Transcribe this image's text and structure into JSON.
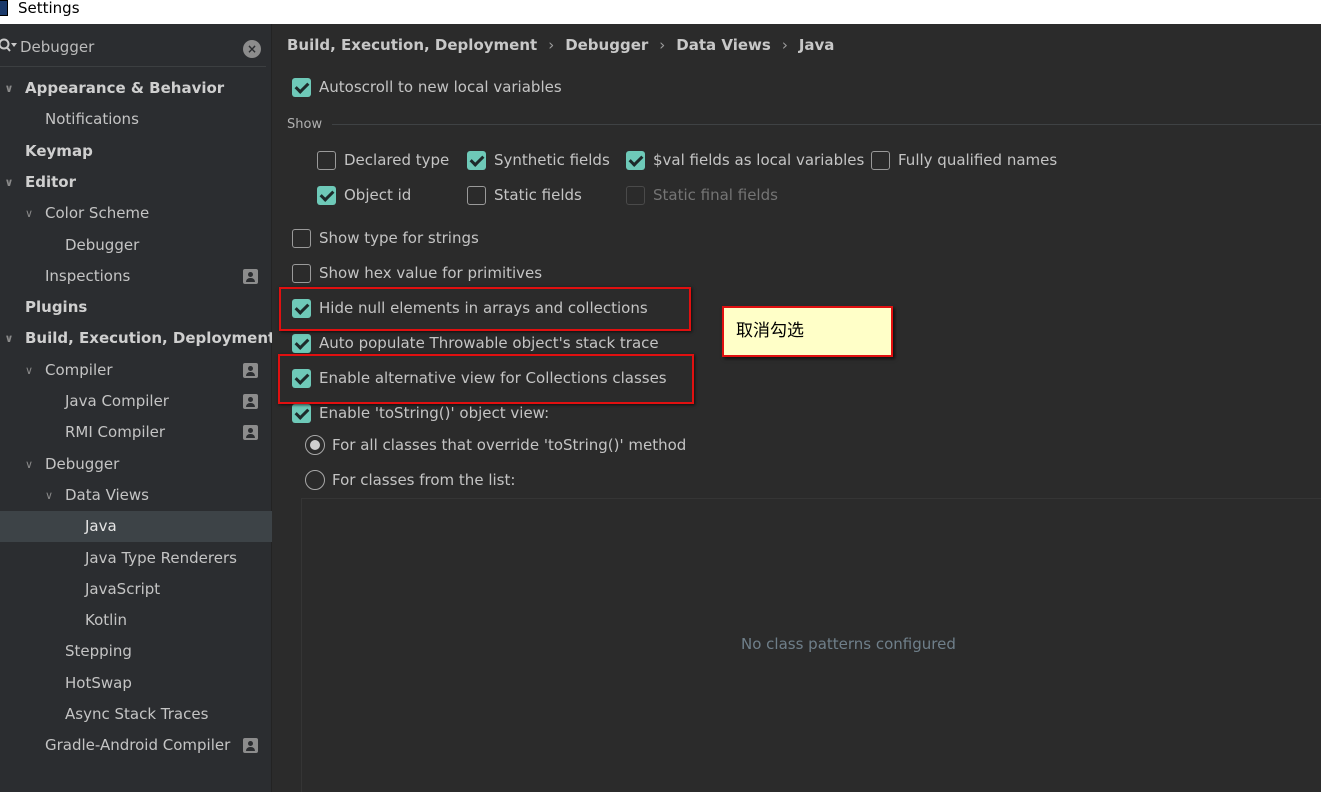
{
  "window": {
    "title": "Settings"
  },
  "search": {
    "value": "Debugger"
  },
  "tree": [
    {
      "label": "Appearance & Behavior",
      "bold": true,
      "chevron": "down",
      "indent": 0
    },
    {
      "label": "Notifications",
      "indent": 1
    },
    {
      "label": "Keymap",
      "bold": true,
      "indent": 0
    },
    {
      "label": "Editor",
      "bold": true,
      "chevron": "down",
      "indent": 0
    },
    {
      "label": "Color Scheme",
      "chevron": "down",
      "indent": 1
    },
    {
      "label": "Debugger",
      "indent": 2
    },
    {
      "label": "Inspections",
      "indent": 1,
      "profile": true
    },
    {
      "label": "Plugins",
      "bold": true,
      "indent": 0
    },
    {
      "label": "Build, Execution, Deployment",
      "bold": true,
      "chevron": "down",
      "indent": 0
    },
    {
      "label": "Compiler",
      "chevron": "down",
      "indent": 1,
      "profile": true
    },
    {
      "label": "Java Compiler",
      "indent": 2,
      "profile": true
    },
    {
      "label": "RMI Compiler",
      "indent": 2,
      "profile": true
    },
    {
      "label": "Debugger",
      "chevron": "down",
      "indent": 1
    },
    {
      "label": "Data Views",
      "chevron": "down",
      "indent": 2
    },
    {
      "label": "Java",
      "indent": 3,
      "selected": true
    },
    {
      "label": "Java Type Renderers",
      "indent": 3
    },
    {
      "label": "JavaScript",
      "indent": 3
    },
    {
      "label": "Kotlin",
      "indent": 3
    },
    {
      "label": "Stepping",
      "indent": 2
    },
    {
      "label": "HotSwap",
      "indent": 2
    },
    {
      "label": "Async Stack Traces",
      "indent": 2
    },
    {
      "label": "Gradle-Android Compiler",
      "indent": 1,
      "profile": true
    }
  ],
  "breadcrumb": [
    "Build, Execution, Deployment",
    "Debugger",
    "Data Views",
    "Java"
  ],
  "options": {
    "autoscroll": {
      "label": "Autoscroll to new local variables",
      "checked": true
    },
    "show_group": "Show",
    "declared_type": {
      "label": "Declared type",
      "checked": false
    },
    "synthetic_fields": {
      "label": "Synthetic fields",
      "checked": true
    },
    "val_fields": {
      "label": "$val fields as local variables",
      "checked": true
    },
    "fully_qualified": {
      "label": "Fully qualified names",
      "checked": false
    },
    "object_id": {
      "label": "Object id",
      "checked": true
    },
    "static_fields": {
      "label": "Static fields",
      "checked": false
    },
    "static_final_fields": {
      "label": "Static final fields",
      "checked": false,
      "disabled": true
    },
    "type_for_strings": {
      "label": "Show type for strings",
      "checked": false
    },
    "hex_value": {
      "label": "Show hex value for primitives",
      "checked": false
    },
    "hide_null": {
      "label": "Hide null elements in arrays and collections",
      "checked": true
    },
    "auto_populate": {
      "label": "Auto populate Throwable object's stack trace",
      "checked": true
    },
    "alt_view": {
      "label": "Enable alternative view for Collections classes",
      "checked": true
    },
    "tostring_view": {
      "label": "Enable 'toString()' object view:",
      "checked": true
    },
    "radio_all": {
      "label": "For all classes that override 'toString()' method",
      "selected": true
    },
    "radio_list": {
      "label": "For classes from the list:",
      "selected": false
    }
  },
  "class_list": {
    "empty_text": "No class patterns configured"
  },
  "annotation": {
    "note": "取消勾选",
    "note_bg": "#ffffc8",
    "box_color": "#e01010"
  },
  "colors": {
    "accent": "#6ec9b8",
    "background": "#2b2b2b",
    "sidebar": "#2b2d30",
    "selection": "#3d4347"
  }
}
